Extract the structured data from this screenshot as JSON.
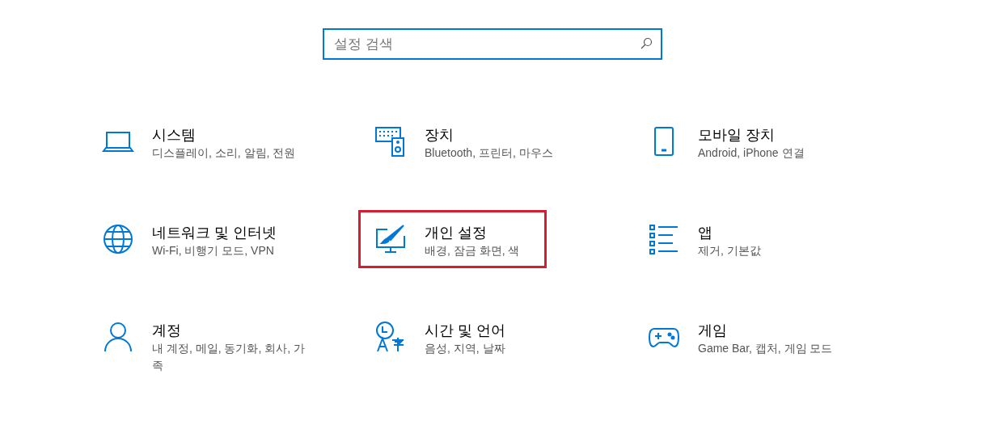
{
  "search": {
    "placeholder": "설정 검색"
  },
  "items": [
    {
      "kind": "laptop",
      "title": "시스템",
      "subtitle": "디스플레이, 소리, 알림, 전원",
      "highlighted": false
    },
    {
      "kind": "devices",
      "title": "장치",
      "subtitle": "Bluetooth, 프린터, 마우스",
      "highlighted": false
    },
    {
      "kind": "phone",
      "title": "모바일 장치",
      "subtitle": "Android, iPhone 연결",
      "highlighted": false
    },
    {
      "kind": "globe",
      "title": "네트워크 및 인터넷",
      "subtitle": "Wi-Fi, 비행기 모드, VPN",
      "highlighted": false
    },
    {
      "kind": "brush",
      "title": "개인 설정",
      "subtitle": "배경, 잠금 화면, 색",
      "highlighted": true
    },
    {
      "kind": "apps",
      "title": "앱",
      "subtitle": "제거, 기본값",
      "highlighted": false
    },
    {
      "kind": "person",
      "title": "계정",
      "subtitle": "내 계정, 메일, 동기화, 회사, 가족",
      "highlighted": false
    },
    {
      "kind": "language",
      "title": "시간 및 언어",
      "subtitle": "음성, 지역, 날짜",
      "highlighted": false
    },
    {
      "kind": "gamepad",
      "title": "게임",
      "subtitle": "Game Bar, 캡처, 게임 모드",
      "highlighted": false
    }
  ]
}
